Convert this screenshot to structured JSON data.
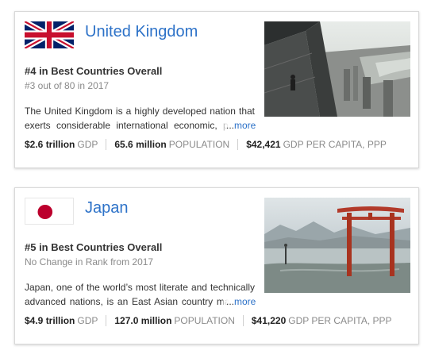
{
  "cards": [
    {
      "country": "United Kingdom",
      "flag_icon": "united-kingdom-flag-icon",
      "rank": "#4 in Best Countries Overall",
      "rank_sub": "#3 out of 80 in 2017",
      "description": "The United Kingdom is a highly developed nation that exerts considerable international economic, political and cultural influence.",
      "more_prefix": "...",
      "more_label": "more",
      "stats": [
        {
          "value": "$2.6 trillion",
          "label": "GDP"
        },
        {
          "value": "65.6 million",
          "label": "POPULATION"
        },
        {
          "value": "$42,421",
          "label": "GDP PER CAPITA, PPP"
        }
      ]
    },
    {
      "country": "Japan",
      "flag_icon": "japan-flag-icon",
      "rank": "#5 in Best Countries Overall",
      "rank_sub": "No Change in Rank from 2017",
      "description": "Japan, one of the world’s most literate and technically advanced nations, is an East Asian country made up of islands.",
      "more_prefix": "...",
      "more_label": "more",
      "stats": [
        {
          "value": "$4.9 trillion",
          "label": "GDP"
        },
        {
          "value": "127.0 million",
          "label": "POPULATION"
        },
        {
          "value": "$41,220",
          "label": "GDP PER CAPITA, PPP"
        }
      ]
    }
  ],
  "colors": {
    "link": "#2d72c8",
    "japan_red": "#bc002d",
    "uk_blue": "#012169",
    "uk_red": "#c8102e"
  }
}
